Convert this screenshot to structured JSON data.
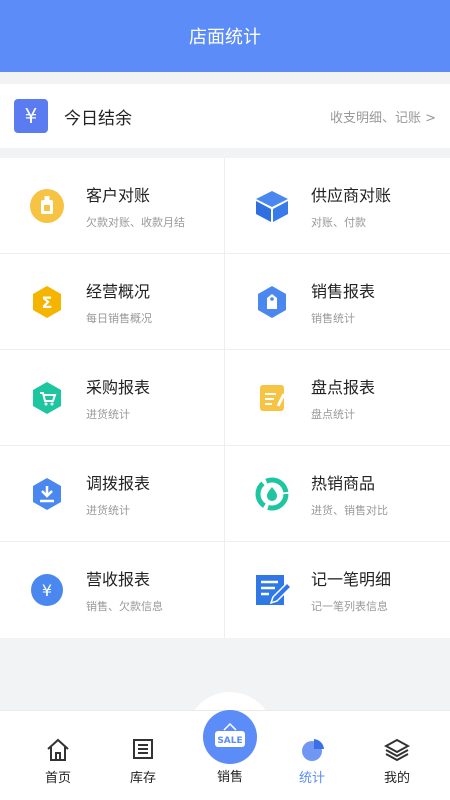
{
  "header": {
    "title": "店面统计"
  },
  "summary": {
    "icon": "yen-icon",
    "title": "今日结余",
    "detail": "收支明细、记账 >"
  },
  "grid": [
    {
      "name": "customer-reconcile",
      "icon": "badge-icon",
      "title": "客户对账",
      "sub": "欠款对账、收款月结"
    },
    {
      "name": "supplier-reconcile",
      "icon": "box-icon",
      "title": "供应商对账",
      "sub": "对账、付款"
    },
    {
      "name": "business-overview",
      "icon": "sigma-icon",
      "title": "经营概况",
      "sub": "每日销售概况"
    },
    {
      "name": "sales-report",
      "icon": "tag-icon",
      "title": "销售报表",
      "sub": "销售统计"
    },
    {
      "name": "purchase-report",
      "icon": "cart-icon",
      "title": "采购报表",
      "sub": "进货统计"
    },
    {
      "name": "inventory-report",
      "icon": "pencil-icon",
      "title": "盘点报表",
      "sub": "盘点统计"
    },
    {
      "name": "transfer-report",
      "icon": "download-icon",
      "title": "调拨报表",
      "sub": "进货统计"
    },
    {
      "name": "hot-products",
      "icon": "drop-cycle-icon",
      "title": "热销商品",
      "sub": "进货、销售对比"
    },
    {
      "name": "revenue-report",
      "icon": "yen-circle-icon",
      "title": "营收报表",
      "sub": "销售、欠款信息"
    },
    {
      "name": "notes-detail",
      "icon": "note-edit-icon",
      "title": "记一笔明细",
      "sub": "记一笔列表信息"
    }
  ],
  "tabs": {
    "home": "首页",
    "stock": "库存",
    "sale": "销售",
    "stats": "统计",
    "mine": "我的",
    "sale_badge": "SALE"
  },
  "colors": {
    "primary": "#5b8cf7",
    "header": "#5b8cf7"
  }
}
